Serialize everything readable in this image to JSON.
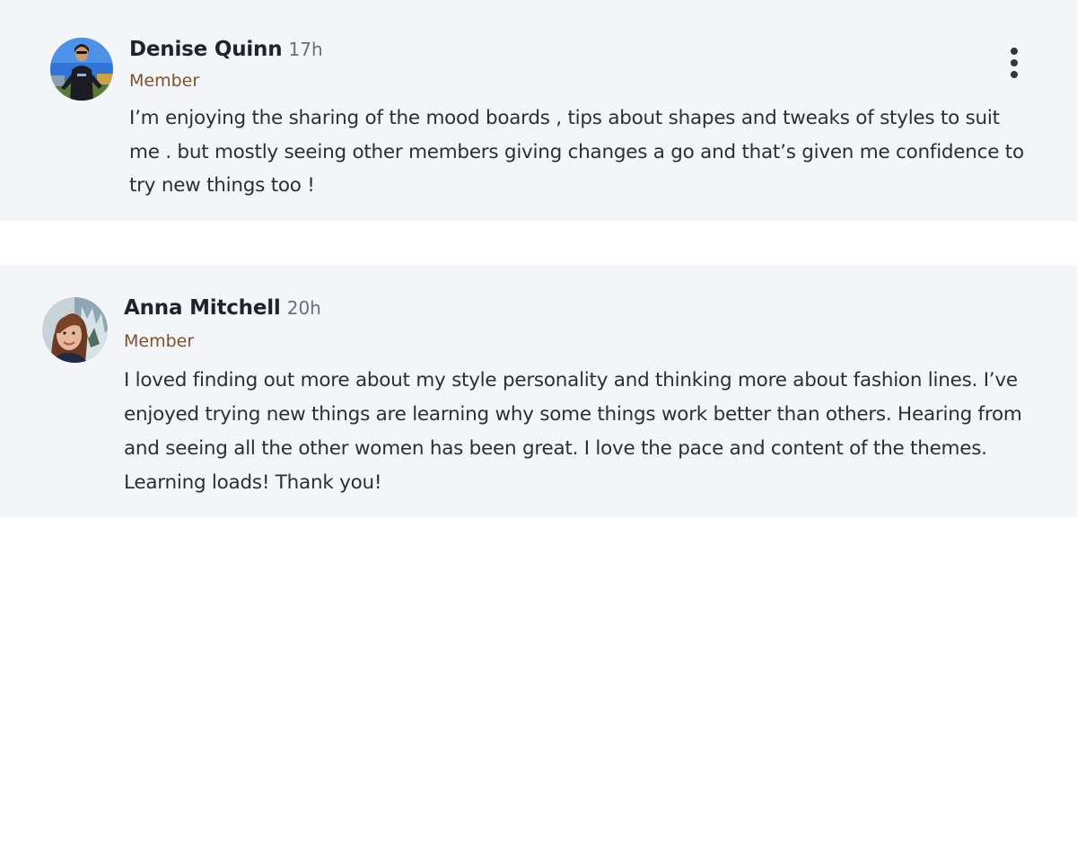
{
  "posts": [
    {
      "author": "Denise Quinn",
      "time": "17h",
      "role": "Member",
      "text": "I’m enjoying the sharing of the mood boards , tips about shapes and tweaks of styles to suit me . but mostly seeing other members giving changes a go and that’s given me confidence to try new things too !",
      "avatar_icon": "avatar-photo",
      "menu_icon": "more-vertical-icon"
    },
    {
      "author": "Anna Mitchell",
      "time": "20h",
      "role": "Member",
      "text": "I loved finding out more about my style personality and thinking more about fashion lines. I’ve enjoyed trying new things are learning why some things work better than others. Hearing from and seeing all the other women has been great. I love the pace and content of the themes. Learning loads! Thank you!",
      "avatar_icon": "avatar-photo"
    }
  ],
  "colors": {
    "card_background": "#f4f5f9",
    "role_color": "#7a5332",
    "name_color": "#1f232b",
    "text_color": "#2b2e35"
  }
}
